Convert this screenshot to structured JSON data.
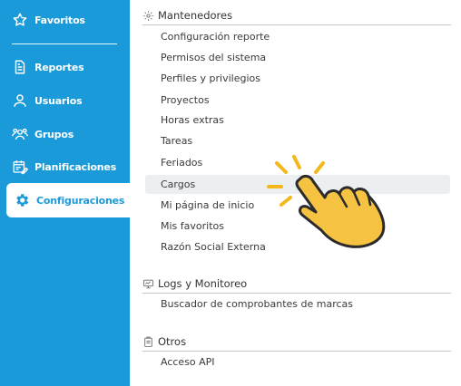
{
  "sidebar": {
    "items": [
      {
        "label": "Favoritos",
        "icon": "star-icon"
      },
      {
        "label": "Reportes",
        "icon": "document-icon"
      },
      {
        "label": "Usuarios",
        "icon": "user-icon"
      },
      {
        "label": "Grupos",
        "icon": "group-icon"
      },
      {
        "label": "Planificaciones",
        "icon": "calendar-edit-icon"
      },
      {
        "label": "Configuraciones",
        "icon": "gear-icon",
        "active": true
      }
    ]
  },
  "sections": {
    "mantenedores": {
      "title": "Mantenedores",
      "icon": "gear-outline-icon",
      "items": [
        "Configuración reporte",
        "Permisos del sistema",
        "Perfiles y privilegios",
        "Proyectos",
        "Horas extras",
        "Tareas",
        "Feriados",
        "Cargos",
        "Mi página de inicio",
        "Mis favoritos",
        "Razón Social Externa"
      ],
      "hovered": "Cargos"
    },
    "logs": {
      "title": "Logs y Monitoreo",
      "icon": "monitor-icon",
      "items": [
        "Buscador de comprobantes de marcas"
      ]
    },
    "otros": {
      "title": "Otros",
      "icon": "clipboard-icon",
      "items": [
        "Acceso API"
      ]
    }
  },
  "colors": {
    "sidebar": "#1a9ad8",
    "hand": "#f5c242"
  }
}
